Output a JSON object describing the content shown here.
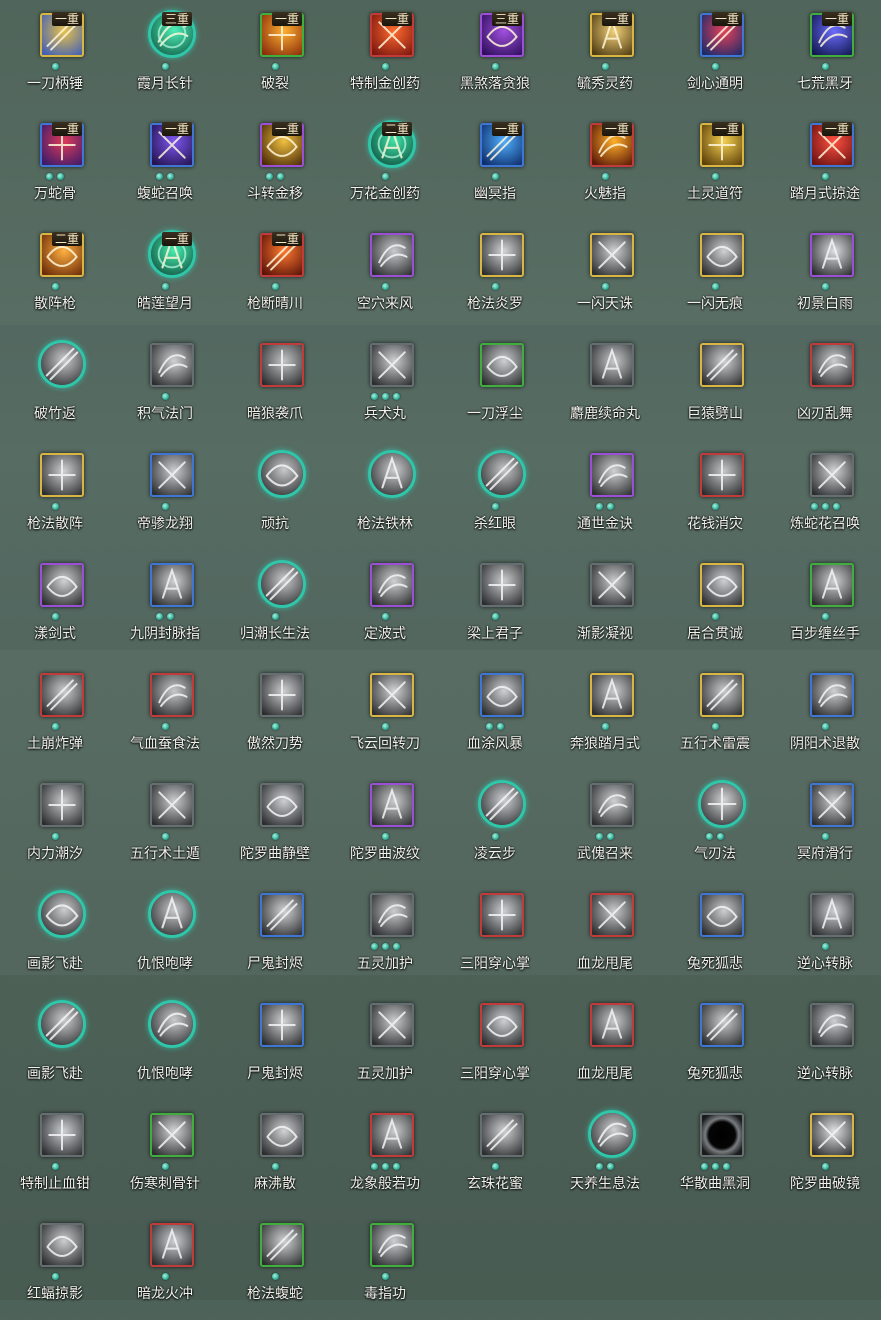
{
  "colors": {
    "gold": "#d9b544",
    "purple": "#9b4fd6",
    "green": "#3fae3c",
    "blue": "#3f76d6",
    "red": "#c23b3b",
    "gray": "#666e72",
    "teal": "#2fc6a9"
  },
  "skills": [
    {
      "name": "一刀柄锤",
      "badge": "一重",
      "dots": 1,
      "frame": "gold",
      "style": "color",
      "tint": [
        "#3f5fb7",
        "#e9c24a"
      ],
      "icon": "blade-swing-icon"
    },
    {
      "name": "霞月长针",
      "badge": "三重",
      "dots": 1,
      "frame": "round",
      "style": "glow",
      "tint": [
        "#0f5a44",
        "#4ff0b8"
      ],
      "icon": "needle-icon"
    },
    {
      "name": "破裂",
      "badge": "一重",
      "dots": 1,
      "frame": "green",
      "style": "color",
      "tint": [
        "#8a2d0c",
        "#ffb030"
      ],
      "icon": "fire-burst-icon"
    },
    {
      "name": "特制金创药",
      "badge": "一重",
      "dots": 1,
      "frame": "red",
      "style": "color",
      "tint": [
        "#7c160e",
        "#ff6a30"
      ],
      "icon": "potion-fire-icon"
    },
    {
      "name": "黑煞落贪狼",
      "badge": "三重",
      "dots": 1,
      "frame": "purple",
      "style": "color",
      "tint": [
        "#2e0f5c",
        "#a24fe0"
      ],
      "icon": "shadow-wolf-icon"
    },
    {
      "name": "毓秀灵药",
      "badge": "一重",
      "dots": 1,
      "frame": "gold",
      "style": "color",
      "tint": [
        "#4f3a10",
        "#f2d27a"
      ],
      "icon": "gourd-icon"
    },
    {
      "name": "剑心通明",
      "badge": "一重",
      "dots": 1,
      "frame": "blue",
      "style": "color",
      "tint": [
        "#182b6a",
        "#e8405a"
      ],
      "icon": "sword-heart-icon"
    },
    {
      "name": "七荒黑牙",
      "badge": "一重",
      "dots": 1,
      "frame": "green",
      "style": "color",
      "tint": [
        "#12184f",
        "#6c6cff"
      ],
      "icon": "black-fang-icon"
    },
    {
      "name": "万蛇骨",
      "badge": "一重",
      "dots": 2,
      "frame": "blue",
      "style": "color",
      "tint": [
        "#3a1b6a",
        "#e03a58"
      ],
      "icon": "snake-bone-icon"
    },
    {
      "name": "蝮蛇召唤",
      "badge": "一重",
      "dots": 2,
      "frame": "blue",
      "style": "color",
      "tint": [
        "#23124f",
        "#7d58f0"
      ],
      "icon": "viper-summon-icon"
    },
    {
      "name": "斗转金移",
      "badge": "一重",
      "dots": 2,
      "frame": "purple",
      "style": "color",
      "tint": [
        "#4a2a08",
        "#f0c040"
      ],
      "icon": "gold-swap-icon"
    },
    {
      "name": "万花金创药",
      "badge": "二重",
      "dots": 1,
      "frame": "round",
      "style": "glow",
      "tint": [
        "#0d4a3a",
        "#3fe5a8"
      ],
      "icon": "flower-potion-icon"
    },
    {
      "name": "幽冥指",
      "badge": "一重",
      "dots": 1,
      "frame": "blue",
      "style": "color",
      "tint": [
        "#0e2c6a",
        "#4fb0ff"
      ],
      "icon": "nether-finger-icon"
    },
    {
      "name": "火魅指",
      "badge": "一重",
      "dots": 1,
      "frame": "red",
      "style": "color",
      "tint": [
        "#5a1608",
        "#ffb028"
      ],
      "icon": "fire-finger-icon"
    },
    {
      "name": "土灵道符",
      "badge": "一重",
      "dots": 1,
      "frame": "gold",
      "style": "color",
      "tint": [
        "#5a3e08",
        "#f5d050"
      ],
      "icon": "earth-talisman-icon"
    },
    {
      "name": "踏月式掠途",
      "badge": "一重",
      "dots": 1,
      "frame": "blue",
      "style": "color",
      "tint": [
        "#6a1212",
        "#ff5040"
      ],
      "icon": "moon-step-icon"
    },
    {
      "name": "散阵枪",
      "badge": "二重",
      "dots": 1,
      "frame": "gold",
      "style": "color",
      "tint": [
        "#6a2a08",
        "#ffb040"
      ],
      "icon": "spear-scatter-icon"
    },
    {
      "name": "皓莲望月",
      "badge": "一重",
      "dots": 1,
      "frame": "round",
      "style": "glow",
      "tint": [
        "#0d4a3a",
        "#48f0b0"
      ],
      "icon": "lotus-moon-icon"
    },
    {
      "name": "枪断晴川",
      "badge": "二重",
      "dots": 1,
      "frame": "red",
      "style": "color",
      "tint": [
        "#5a1208",
        "#ff7a30"
      ],
      "icon": "spear-break-icon"
    },
    {
      "name": "空穴来风",
      "badge": "",
      "dots": 1,
      "frame": "purple",
      "style": "gray",
      "tint": [
        "#2a2c2e",
        "#c8cbcd"
      ],
      "icon": "coin-wind-icon"
    },
    {
      "name": "枪法炎罗",
      "badge": "",
      "dots": 1,
      "frame": "gold",
      "style": "gray",
      "tint": [
        "#2a2c2e",
        "#d2d4d6"
      ],
      "icon": "spear-flame-icon"
    },
    {
      "name": "一闪天诛",
      "badge": "",
      "dots": 1,
      "frame": "gold",
      "style": "gray",
      "tint": [
        "#2a2c2e",
        "#d0d2d4"
      ],
      "icon": "flash-strike-icon"
    },
    {
      "name": "一闪无痕",
      "badge": "",
      "dots": 1,
      "frame": "gold",
      "style": "gray",
      "tint": [
        "#2a2c2e",
        "#cfd1d3"
      ],
      "icon": "flash-trace-icon"
    },
    {
      "name": "初景白雨",
      "badge": "",
      "dots": 1,
      "frame": "purple",
      "style": "gray",
      "tint": [
        "#2a2c2e",
        "#dcdfe1"
      ],
      "icon": "white-rain-icon"
    },
    {
      "name": "破竹返",
      "badge": "",
      "dots": 0,
      "frame": "round",
      "style": "gray",
      "tint": [
        "#26282a",
        "#c9cbcd"
      ],
      "icon": "bamboo-break-icon"
    },
    {
      "name": "积气法门",
      "badge": "",
      "dots": 1,
      "frame": "gray",
      "style": "gray",
      "tint": [
        "#2a2c2e",
        "#d0d2d4"
      ],
      "icon": "qi-gate-icon"
    },
    {
      "name": "暗狼袭爪",
      "badge": "",
      "dots": 0,
      "frame": "red",
      "style": "gray",
      "tint": [
        "#2a2c2e",
        "#c2c4c6"
      ],
      "icon": "wolf-claw-icon"
    },
    {
      "name": "兵犬丸",
      "badge": "",
      "dots": 3,
      "frame": "gray",
      "style": "gray",
      "tint": [
        "#2a2c2e",
        "#cfd1d3"
      ],
      "icon": "war-dog-pill-icon"
    },
    {
      "name": "一刀浮尘",
      "badge": "",
      "dots": 0,
      "frame": "green",
      "style": "gray",
      "tint": [
        "#2a2c2e",
        "#cdd0d2"
      ],
      "icon": "dust-blade-icon"
    },
    {
      "name": "麝鹿续命丸",
      "badge": "",
      "dots": 0,
      "frame": "gray",
      "style": "gray",
      "tint": [
        "#2a2c2e",
        "#c8cacc"
      ],
      "icon": "musk-pill-icon"
    },
    {
      "name": "巨猿劈山",
      "badge": "",
      "dots": 0,
      "frame": "gold",
      "style": "gray",
      "tint": [
        "#2a2c2e",
        "#cfd1d3"
      ],
      "icon": "giant-ape-icon"
    },
    {
      "name": "凶刃乱舞",
      "badge": "",
      "dots": 0,
      "frame": "red",
      "style": "gray",
      "tint": [
        "#2a2c2e",
        "#cbcdcf"
      ],
      "icon": "blade-dance-icon"
    },
    {
      "name": "枪法散阵",
      "badge": "",
      "dots": 1,
      "frame": "gold",
      "style": "gray",
      "tint": [
        "#2a2c2e",
        "#cfd1d3"
      ],
      "icon": "spear-array-icon"
    },
    {
      "name": "帝骖龙翔",
      "badge": "",
      "dots": 1,
      "frame": "blue",
      "style": "gray",
      "tint": [
        "#2a2c2e",
        "#cdd0d2"
      ],
      "icon": "dragon-soar-icon"
    },
    {
      "name": "顽抗",
      "badge": "",
      "dots": 0,
      "frame": "round",
      "style": "gray",
      "tint": [
        "#26282a",
        "#c7c9cb"
      ],
      "icon": "resist-icon"
    },
    {
      "name": "枪法铁林",
      "badge": "",
      "dots": 0,
      "frame": "round",
      "style": "gray",
      "tint": [
        "#26282a",
        "#ccced0"
      ],
      "icon": "iron-forest-icon"
    },
    {
      "name": "杀红眼",
      "badge": "",
      "dots": 1,
      "frame": "round",
      "style": "gray",
      "tint": [
        "#26282a",
        "#c5c7c9"
      ],
      "icon": "red-eye-icon"
    },
    {
      "name": "通世金诀",
      "badge": "",
      "dots": 2,
      "frame": "purple",
      "style": "gray",
      "tint": [
        "#2a2c2e",
        "#cfd1d3"
      ],
      "icon": "dice-icon"
    },
    {
      "name": "花钱消灾",
      "badge": "",
      "dots": 1,
      "frame": "red",
      "style": "gray",
      "tint": [
        "#2a2c2e",
        "#c4c6c8"
      ],
      "icon": "money-bag-icon"
    },
    {
      "name": "炼蛇花召唤",
      "badge": "",
      "dots": 3,
      "frame": "gray",
      "style": "gray",
      "tint": [
        "#2a2c2e",
        "#d3d5d7"
      ],
      "icon": "snake-flower-icon"
    },
    {
      "name": "漾剑式",
      "badge": "",
      "dots": 1,
      "frame": "purple",
      "style": "gray",
      "tint": [
        "#2a2c2e",
        "#cfd1d3"
      ],
      "icon": "ripple-sword-icon"
    },
    {
      "name": "九阴封脉指",
      "badge": "",
      "dots": 2,
      "frame": "blue",
      "style": "gray",
      "tint": [
        "#2a2c2e",
        "#d0d2d4"
      ],
      "icon": "seal-finger-icon"
    },
    {
      "name": "归潮长生法",
      "badge": "",
      "dots": 1,
      "frame": "round",
      "style": "gray",
      "tint": [
        "#26282a",
        "#c8cacc"
      ],
      "icon": "tide-life-icon"
    },
    {
      "name": "定波式",
      "badge": "",
      "dots": 1,
      "frame": "purple",
      "style": "gray",
      "tint": [
        "#2a2c2e",
        "#cfd1d3"
      ],
      "icon": "calm-wave-icon"
    },
    {
      "name": "梁上君子",
      "badge": "",
      "dots": 1,
      "frame": "gray",
      "style": "gray",
      "tint": [
        "#2a2c2e",
        "#cbcdcf"
      ],
      "icon": "thief-icon"
    },
    {
      "name": "渐影凝视",
      "badge": "",
      "dots": 0,
      "frame": "gray",
      "style": "gray",
      "tint": [
        "#2a2c2e",
        "#c9cbcd"
      ],
      "icon": "shadow-gaze-icon"
    },
    {
      "name": "居合贯诚",
      "badge": "",
      "dots": 1,
      "frame": "gold",
      "style": "gray",
      "tint": [
        "#2a2c2e",
        "#cdd0d2"
      ],
      "icon": "iai-strike-icon"
    },
    {
      "name": "百步缠丝手",
      "badge": "",
      "dots": 1,
      "frame": "green",
      "style": "gray",
      "tint": [
        "#2a2c2e",
        "#cfd1d3"
      ],
      "icon": "silk-hand-icon"
    },
    {
      "name": "土崩炸弹",
      "badge": "",
      "dots": 1,
      "frame": "red",
      "style": "gray",
      "tint": [
        "#2a2c2e",
        "#cbcdcf"
      ],
      "icon": "earth-bomb-icon"
    },
    {
      "name": "气血蚕食法",
      "badge": "",
      "dots": 1,
      "frame": "red",
      "style": "gray",
      "tint": [
        "#2a2c2e",
        "#c7c9cb"
      ],
      "icon": "blood-drain-icon"
    },
    {
      "name": "傲然刀势",
      "badge": "",
      "dots": 1,
      "frame": "gray",
      "style": "gray",
      "tint": [
        "#2a2c2e",
        "#ccced0"
      ],
      "icon": "proud-blade-icon"
    },
    {
      "name": "飞云回转刀",
      "badge": "",
      "dots": 1,
      "frame": "gold",
      "style": "gray",
      "tint": [
        "#2a2c2e",
        "#d2d4d6"
      ],
      "icon": "cloud-blade-icon"
    },
    {
      "name": "血涂风暴",
      "badge": "",
      "dots": 2,
      "frame": "blue",
      "style": "gray",
      "tint": [
        "#2a2c2e",
        "#cdd0d2"
      ],
      "icon": "blood-storm-icon"
    },
    {
      "name": "奔狼踏月式",
      "badge": "",
      "dots": 1,
      "frame": "gold",
      "style": "gray",
      "tint": [
        "#2a2c2e",
        "#cbcdcf"
      ],
      "icon": "running-wolf-icon"
    },
    {
      "name": "五行术雷震",
      "badge": "",
      "dots": 1,
      "frame": "gold",
      "style": "gray",
      "tint": [
        "#2a2c2e",
        "#c9cbcd"
      ],
      "icon": "thunder-icon"
    },
    {
      "name": "阴阳术退散",
      "badge": "",
      "dots": 1,
      "frame": "blue",
      "style": "gray",
      "tint": [
        "#2a2c2e",
        "#cfd1d3"
      ],
      "icon": "yin-yang-icon"
    },
    {
      "name": "内力潮汐",
      "badge": "",
      "dots": 1,
      "frame": "gray",
      "style": "gray",
      "tint": [
        "#2a2c2e",
        "#c9cbcd"
      ],
      "icon": "inner-tide-icon"
    },
    {
      "name": "五行术土遁",
      "badge": "",
      "dots": 1,
      "frame": "gray",
      "style": "gray",
      "tint": [
        "#2a2c2e",
        "#cbcdcf"
      ],
      "icon": "earth-escape-icon"
    },
    {
      "name": "陀罗曲静壁",
      "badge": "",
      "dots": 1,
      "frame": "gray",
      "style": "gray",
      "tint": [
        "#2a2c2e",
        "#cdd0d2"
      ],
      "icon": "still-wall-icon"
    },
    {
      "name": "陀罗曲波纹",
      "badge": "",
      "dots": 1,
      "frame": "purple",
      "style": "gray",
      "tint": [
        "#2a2c2e",
        "#cbcdcf"
      ],
      "icon": "ripple-icon"
    },
    {
      "name": "凌云步",
      "badge": "",
      "dots": 1,
      "frame": "round",
      "style": "gray",
      "tint": [
        "#26282a",
        "#cdd0d2"
      ],
      "icon": "cloud-step-icon"
    },
    {
      "name": "武傀召来",
      "badge": "",
      "dots": 2,
      "frame": "gray",
      "style": "gray",
      "tint": [
        "#2a2c2e",
        "#cfd1d3"
      ],
      "icon": "puppet-summon-icon"
    },
    {
      "name": "气刃法",
      "badge": "",
      "dots": 2,
      "frame": "round",
      "style": "gray",
      "tint": [
        "#26282a",
        "#d0d2d4"
      ],
      "icon": "qi-blade-icon"
    },
    {
      "name": "冥府滑行",
      "badge": "",
      "dots": 1,
      "frame": "blue",
      "style": "gray",
      "tint": [
        "#2a2c2e",
        "#c9cbcd"
      ],
      "icon": "underworld-glide-icon"
    },
    {
      "name": "画影飞赴",
      "badge": "",
      "dots": 0,
      "frame": "round",
      "style": "gray",
      "tint": [
        "#26282a",
        "#cbcdcf"
      ],
      "icon": "shadow-fly-icon"
    },
    {
      "name": "仇恨咆哮",
      "badge": "",
      "dots": 0,
      "frame": "round",
      "style": "gray",
      "tint": [
        "#26282a",
        "#c9cbcd"
      ],
      "icon": "roar-icon"
    },
    {
      "name": "尸鬼封烬",
      "badge": "",
      "dots": 0,
      "frame": "blue",
      "style": "gray",
      "tint": [
        "#2a2c2e",
        "#d0d2d4"
      ],
      "icon": "ghoul-seal-icon"
    },
    {
      "name": "五灵加护",
      "badge": "",
      "dots": 3,
      "frame": "gray",
      "style": "gray",
      "tint": [
        "#2a2c2e",
        "#cbcdcf"
      ],
      "icon": "five-spirit-icon"
    },
    {
      "name": "三阳穿心掌",
      "badge": "",
      "dots": 0,
      "frame": "red",
      "style": "gray",
      "tint": [
        "#2a2c2e",
        "#cdd0d2"
      ],
      "icon": "heart-palm-icon"
    },
    {
      "name": "血龙甩尾",
      "badge": "",
      "dots": 0,
      "frame": "red",
      "style": "gray",
      "tint": [
        "#2a2c2e",
        "#c9cbcd"
      ],
      "icon": "dragon-tail-icon"
    },
    {
      "name": "兔死狐悲",
      "badge": "",
      "dots": 0,
      "frame": "blue",
      "style": "gray",
      "tint": [
        "#2a2c2e",
        "#cbcdcf"
      ],
      "icon": "fox-grief-icon"
    },
    {
      "name": "逆心转脉",
      "badge": "",
      "dots": 1,
      "frame": "gray",
      "style": "gray",
      "tint": [
        "#2a2c2e",
        "#cdd0d2"
      ],
      "icon": "reverse-pulse-icon"
    },
    {
      "name": "画影飞赴",
      "badge": "",
      "dots": 0,
      "frame": "round",
      "style": "gray",
      "tint": [
        "#26282a",
        "#cbcdcf"
      ],
      "icon": "shadow-fly-icon"
    },
    {
      "name": "仇恨咆哮",
      "badge": "",
      "dots": 0,
      "frame": "round",
      "style": "gray",
      "tint": [
        "#26282a",
        "#c9cbcd"
      ],
      "icon": "roar-icon"
    },
    {
      "name": "尸鬼封烬",
      "badge": "",
      "dots": 0,
      "frame": "blue",
      "style": "gray",
      "tint": [
        "#2a2c2e",
        "#d0d2d4"
      ],
      "icon": "ghoul-seal-icon"
    },
    {
      "name": "五灵加护",
      "badge": "",
      "dots": 0,
      "frame": "gray",
      "style": "gray",
      "tint": [
        "#2a2c2e",
        "#cbcdcf"
      ],
      "icon": "five-spirit-icon"
    },
    {
      "name": "三阳穿心掌",
      "badge": "",
      "dots": 0,
      "frame": "red",
      "style": "gray",
      "tint": [
        "#2a2c2e",
        "#cdd0d2"
      ],
      "icon": "heart-palm-icon"
    },
    {
      "name": "血龙甩尾",
      "badge": "",
      "dots": 0,
      "frame": "red",
      "style": "gray",
      "tint": [
        "#2a2c2e",
        "#c9cbcd"
      ],
      "icon": "dragon-tail-icon"
    },
    {
      "name": "兔死狐悲",
      "badge": "",
      "dots": 0,
      "frame": "blue",
      "style": "gray",
      "tint": [
        "#2a2c2e",
        "#cbcdcf"
      ],
      "icon": "fox-grief-icon"
    },
    {
      "name": "逆心转脉",
      "badge": "",
      "dots": 0,
      "frame": "gray",
      "style": "gray",
      "tint": [
        "#2a2c2e",
        "#cdd0d2"
      ],
      "icon": "reverse-pulse-icon"
    },
    {
      "name": "特制止血钳",
      "badge": "",
      "dots": 1,
      "frame": "gray",
      "style": "gray",
      "tint": [
        "#2a2c2e",
        "#cdd0d2"
      ],
      "icon": "clamp-icon"
    },
    {
      "name": "伤寒刺骨针",
      "badge": "",
      "dots": 1,
      "frame": "green",
      "style": "gray",
      "tint": [
        "#2a2c2e",
        "#d3d5d7"
      ],
      "icon": "bone-needle-icon"
    },
    {
      "name": "麻沸散",
      "badge": "",
      "dots": 1,
      "frame": "gray",
      "style": "gray",
      "tint": [
        "#2a2c2e",
        "#d0d2d4"
      ],
      "icon": "anesthetic-icon"
    },
    {
      "name": "龙象般若功",
      "badge": "",
      "dots": 3,
      "frame": "red",
      "style": "gray",
      "tint": [
        "#2a2c2e",
        "#cbcdcf"
      ],
      "icon": "dragon-elephant-icon"
    },
    {
      "name": "玄珠花蜜",
      "badge": "",
      "dots": 1,
      "frame": "gray",
      "style": "gray",
      "tint": [
        "#2a2c2e",
        "#cfd1d3"
      ],
      "icon": "nectar-icon"
    },
    {
      "name": "天养生息法",
      "badge": "",
      "dots": 2,
      "frame": "round",
      "style": "gray",
      "tint": [
        "#26282a",
        "#d0d2d4"
      ],
      "icon": "heaven-breath-icon"
    },
    {
      "name": "华散曲黑洞",
      "badge": "",
      "dots": 3,
      "frame": "gray",
      "style": "hole",
      "tint": [
        "#000000",
        "#6a6d70"
      ],
      "icon": "black-hole-icon"
    },
    {
      "name": "陀罗曲破镜",
      "badge": "",
      "dots": 1,
      "frame": "gold",
      "style": "gray",
      "tint": [
        "#2a2c2e",
        "#e0e2e4"
      ],
      "icon": "broken-mirror-icon"
    },
    {
      "name": "红蝠掠影",
      "badge": "",
      "dots": 1,
      "frame": "gray",
      "style": "gray",
      "tint": [
        "#2a2c2e",
        "#cbcdcf"
      ],
      "icon": "red-bat-icon"
    },
    {
      "name": "暗龙火冲",
      "badge": "",
      "dots": 1,
      "frame": "red",
      "style": "gray",
      "tint": [
        "#2a2c2e",
        "#cdd0d2"
      ],
      "icon": "dark-dragon-icon"
    },
    {
      "name": "枪法蝮蛇",
      "badge": "",
      "dots": 1,
      "frame": "green",
      "style": "gray",
      "tint": [
        "#2a2c2e",
        "#cfd1d3"
      ],
      "icon": "viper-spear-icon"
    },
    {
      "name": "毒指功",
      "badge": "",
      "dots": 1,
      "frame": "green",
      "style": "gray",
      "tint": [
        "#2a2c2e",
        "#cdd0d2"
      ],
      "icon": "poison-finger-icon"
    }
  ]
}
